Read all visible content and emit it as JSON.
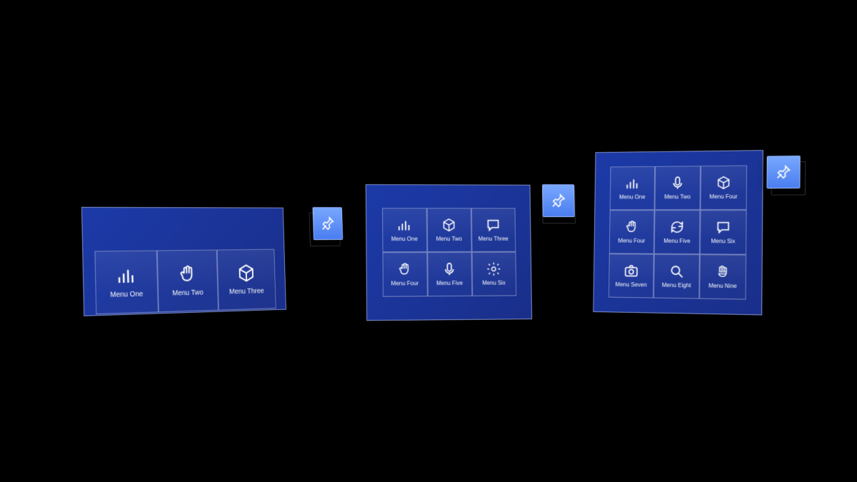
{
  "panels": [
    {
      "id": "panel1",
      "pin_icon": "pin",
      "cells": [
        {
          "icon": "bar-chart",
          "label": "Menu One"
        },
        {
          "icon": "hand",
          "label": "Menu Two"
        },
        {
          "icon": "cube",
          "label": "Menu Three"
        }
      ]
    },
    {
      "id": "panel2",
      "pin_icon": "pin",
      "cells": [
        {
          "icon": "bar-chart",
          "label": "Menu One"
        },
        {
          "icon": "cube",
          "label": "Menu Two"
        },
        {
          "icon": "chat",
          "label": "Menu Three"
        },
        {
          "icon": "hand",
          "label": "Menu Four"
        },
        {
          "icon": "mic",
          "label": "Menu Five"
        },
        {
          "icon": "gear",
          "label": "Menu Six"
        }
      ]
    },
    {
      "id": "panel3",
      "pin_icon": "pin",
      "cells": [
        {
          "icon": "bar-chart",
          "label": "Menu One"
        },
        {
          "icon": "mic",
          "label": "Menu Two"
        },
        {
          "icon": "cube",
          "label": "Menu Four"
        },
        {
          "icon": "hand",
          "label": "Menu Four"
        },
        {
          "icon": "refresh",
          "label": "Menu Five"
        },
        {
          "icon": "chat",
          "label": "Menu Six"
        },
        {
          "icon": "camera",
          "label": "Menu Seven"
        },
        {
          "icon": "search",
          "label": "Menu Eight"
        },
        {
          "icon": "hand-mesh",
          "label": "Menu Nine"
        }
      ]
    }
  ],
  "colors": {
    "panel_bg": "#1c3aa8",
    "pin_bg": "#5c8cf5",
    "stroke": "#ffffff"
  }
}
